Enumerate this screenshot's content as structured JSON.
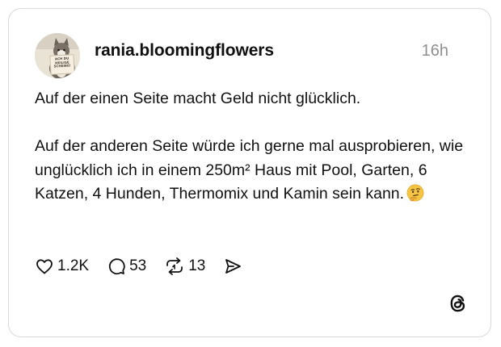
{
  "post": {
    "username": "rania.bloomingflowers",
    "timestamp": "16h",
    "avatar_sign_text": "ACH DU HEILIGE SCHEIBE!",
    "paragraph_1": "Auf der einen Seite macht Geld nicht glücklich.",
    "paragraph_2": "Auf der anderen Seite würde ich gerne mal ausprobieren, wie unglücklich ich in einem 250m² Haus mit Pool, Garten, 6 Katzen, 4 Hunden, Thermomix und Kamin sein kann.",
    "emoji": "thinking-face-emoji"
  },
  "actions": {
    "likes": "1.2K",
    "comments": "53",
    "reposts": "13",
    "like_icon": "heart-icon",
    "comment_icon": "speech-bubble-icon",
    "repost_icon": "repost-icon",
    "share_icon": "send-icon"
  },
  "brand": {
    "logo": "threads-logo-icon",
    "text_color": "#101010",
    "muted_color": "#8f8f8f",
    "border_color": "#d9d9d9"
  }
}
